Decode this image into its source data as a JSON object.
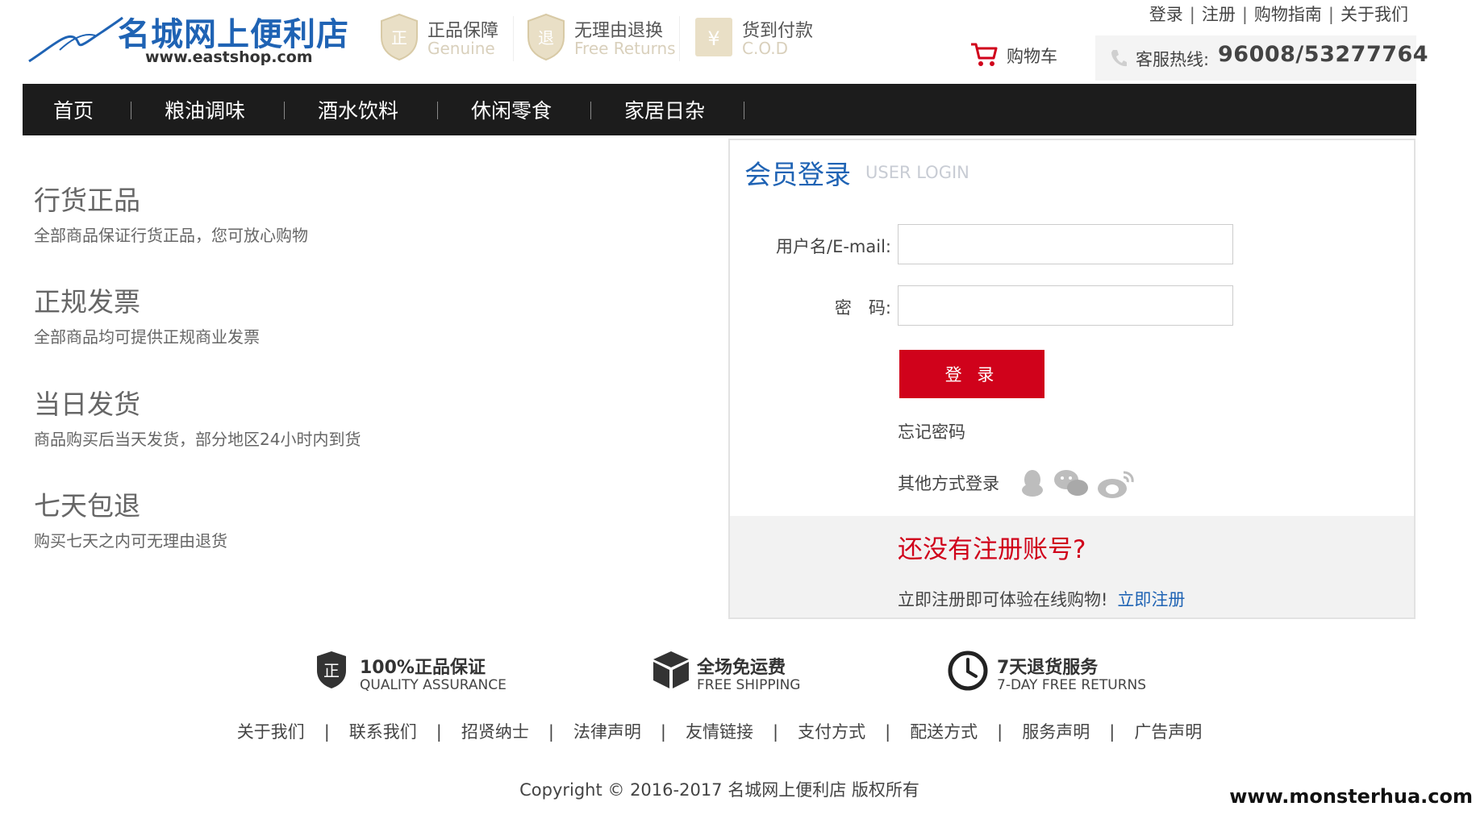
{
  "header": {
    "logo_title": "名城网上便利店",
    "logo_url": "www.eastshop.com",
    "badges": [
      {
        "cn": "正品保障",
        "en": "Genuine",
        "icon": "genuine-shield-icon"
      },
      {
        "cn": "无理由退换",
        "en": "Free Returns",
        "icon": "returns-shield-icon"
      },
      {
        "cn": "货到付款",
        "en": "C.O.D",
        "icon": "cod-icon"
      }
    ],
    "top_links": [
      "登录",
      "注册",
      "购物指南",
      "关于我们"
    ],
    "cart_label": "购物车",
    "hotline_label": "客服热线:",
    "hotline_number": "96008/53277764"
  },
  "nav": {
    "items": [
      "首页",
      "粮油调味",
      "酒水饮料",
      "休闲零食",
      "家居日杂"
    ]
  },
  "features": [
    {
      "title": "行货正品",
      "desc": "全部商品保证行货正品，您可放心购物"
    },
    {
      "title": "正规发票",
      "desc": "全部商品均可提供正规商业发票"
    },
    {
      "title": "当日发货",
      "desc": "商品购买后当天发货，部分地区24小时内到货"
    },
    {
      "title": "七天包退",
      "desc": "购买七天之内可无理由退货"
    }
  ],
  "login": {
    "title": "会员登录",
    "subtitle": "USER LOGIN",
    "username_label": "用户名/E-mail:",
    "username_value": "",
    "password_label": "密　码:",
    "password_value": "",
    "submit_label": "登 录",
    "forgot_label": "忘记密码",
    "other_label": "其他方式登录",
    "social": [
      "qq-icon",
      "wechat-icon",
      "weibo-icon"
    ],
    "register_question": "还没有注册账号?",
    "register_text": "立即注册即可体验在线购物!",
    "register_link": "立即注册"
  },
  "services": [
    {
      "cn": "100%正品保证",
      "en": "QUALITY ASSURANCE",
      "icon": "quality-shield-icon"
    },
    {
      "cn": "全场免运费",
      "en": "FREE SHIPPING",
      "icon": "box-icon"
    },
    {
      "cn": "7天退货服务",
      "en": "7-DAY FREE RETURNS",
      "icon": "clock-icon"
    }
  ],
  "footer": {
    "links": [
      "关于我们",
      "联系我们",
      "招贤纳士",
      "法律声明",
      "友情链接",
      "支付方式",
      "配送方式",
      "服务声明",
      "广告声明"
    ],
    "copyright": "Copyright © 2016-2017 名城网上便利店 版权所有"
  },
  "watermark": "www.monsterhua.com",
  "colors": {
    "brand_blue": "#1f63b4",
    "accent_red": "#d0021b",
    "nav_bg": "#1c1c1c"
  }
}
